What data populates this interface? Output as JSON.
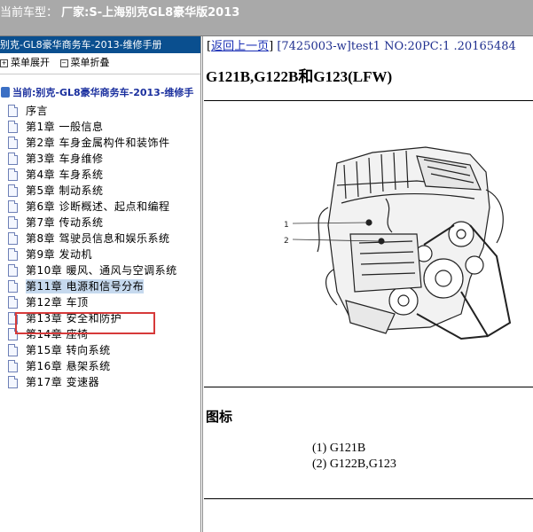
{
  "topbar": {
    "prefix": "当前车型：",
    "text": "厂家:S-上海别克GL8豪华版2013"
  },
  "left": {
    "header": "别克-GL8豪华商务车-2013-维修手册",
    "tools": {
      "expand": "菜单展开",
      "collapse": "菜单折叠"
    },
    "root": "当前:别克-GL8豪华商务车-2013-维修手",
    "items": [
      "序言",
      "第1章 一般信息",
      "第2章 车身金属构件和装饰件",
      "第3章 车身维修",
      "第4章 车身系统",
      "第5章 制动系统",
      "第6章 诊断概述、起点和编程",
      "第7章 传动系统",
      "第8章 驾驶员信息和娱乐系统",
      "第9章 发动机",
      "第10章 暖风、通风与空调系统",
      "第11章 电源和信号分布",
      "第12章 车顶",
      "第13章 安全和防护",
      "第14章 座椅",
      "第15章 转向系统",
      "第16章 悬架系统",
      "第17章 变速器"
    ],
    "selected_index": 11
  },
  "right": {
    "back_link": "返回上一页",
    "meta": "[7425003-w]test1 NO:20PC:1 .20165484",
    "title": "G121B,G122B和G123(LFW)",
    "callouts": [
      "1",
      "2"
    ],
    "legend_heading": "图标",
    "legend": [
      "(1) G121B",
      "(2) G122B,G123"
    ]
  }
}
